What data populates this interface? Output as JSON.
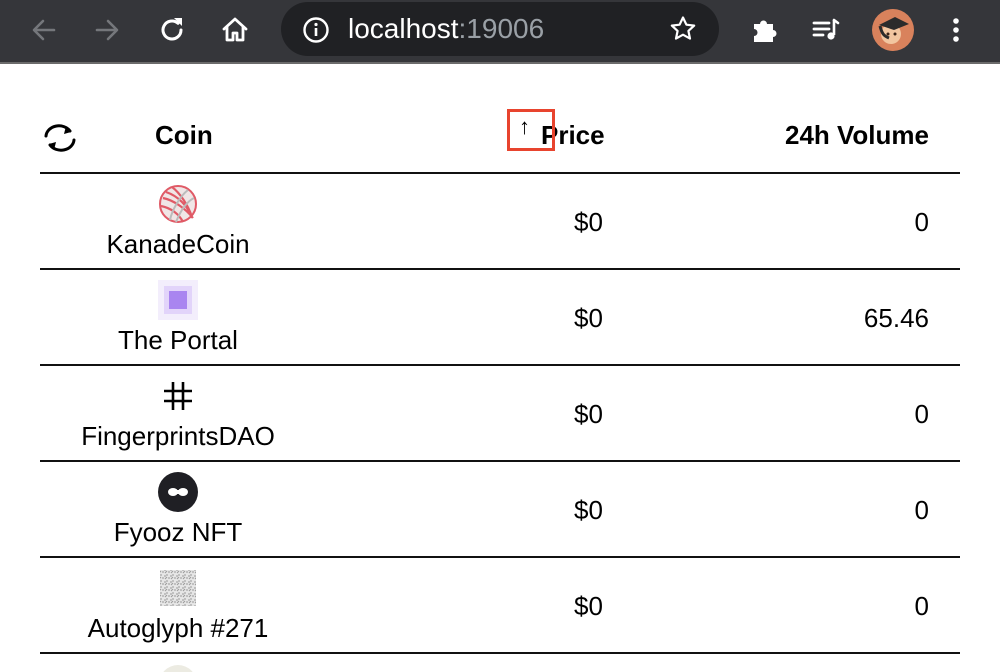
{
  "browser": {
    "url_host": "localhost",
    "url_port": ":19006"
  },
  "table": {
    "headers": {
      "coin": "Coin",
      "price": "Price",
      "volume": "24h Volume"
    },
    "sort_indicator": "↑",
    "rows": [
      {
        "name": "KanadeCoin",
        "price": "$0",
        "volume": "0",
        "icon": "yarn-ball-icon"
      },
      {
        "name": "The Portal",
        "price": "$0",
        "volume": "65.46",
        "icon": "purple-square-icon"
      },
      {
        "name": "FingerprintsDAO",
        "price": "$0",
        "volume": "0",
        "icon": "hash-icon"
      },
      {
        "name": "Fyooz NFT",
        "price": "$0",
        "volume": "0",
        "icon": "infinity-icon"
      },
      {
        "name": "Autoglyph #271",
        "price": "$0",
        "volume": "0",
        "icon": "noise-pattern-icon"
      }
    ]
  },
  "colors": {
    "toolbar_bg": "#35363a",
    "omnibox_bg": "#202124",
    "highlight": "#e8442e"
  }
}
